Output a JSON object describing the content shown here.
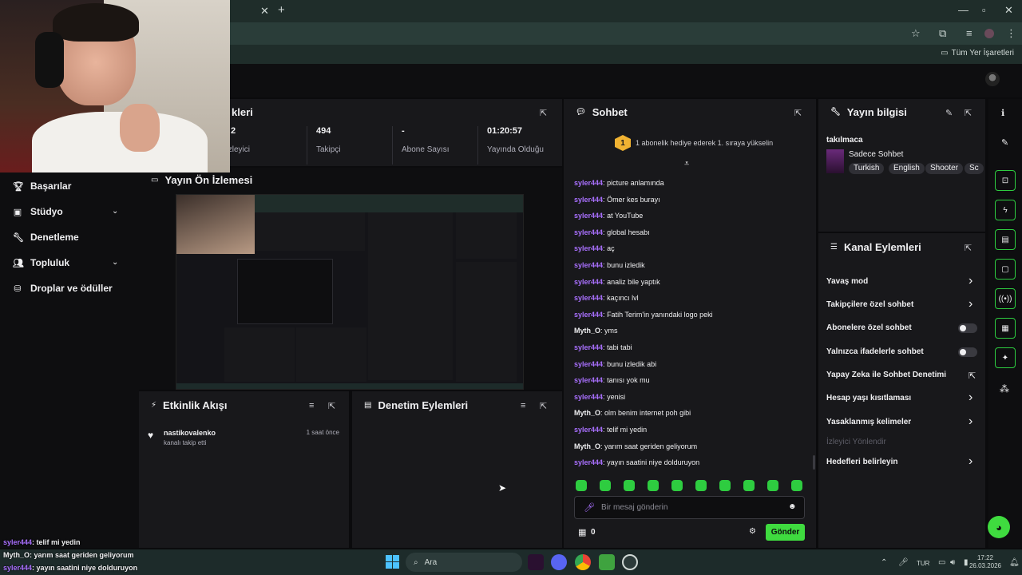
{
  "browser": {
    "bookmarks_all": "Tüm Yer İşaretleri"
  },
  "sidebar": {
    "items": [
      {
        "label": "Başarılar",
        "icon": "trophy-icon"
      },
      {
        "label": "Stüdyo",
        "icon": "studio-icon",
        "expandable": true
      },
      {
        "label": "Denetleme",
        "icon": "wrench-icon"
      },
      {
        "label": "Topluluk",
        "icon": "community-icon",
        "expandable": true
      },
      {
        "label": "Droplar ve ödüller",
        "icon": "drops-icon"
      }
    ]
  },
  "stats": {
    "title_fragment": "kleri",
    "cells": [
      {
        "value": "2",
        "label": "İzleyici"
      },
      {
        "value": "494",
        "label": "Takipçi"
      },
      {
        "value": "-",
        "label": "Abone Sayısı"
      },
      {
        "value": "01:20:57",
        "label": "Yayında Olduğu"
      }
    ]
  },
  "preview": {
    "title": "Yayın Ön İzlemesi"
  },
  "activity": {
    "title": "Etkinlik Akışı",
    "events": [
      {
        "user": "nastikovalenko",
        "text": "kanalı takip etti",
        "time": "1 saat önce"
      }
    ]
  },
  "moderation": {
    "title": "Denetim Eylemleri"
  },
  "chat": {
    "title": "Sohbet",
    "gift_banner": "1 abonelik hediye ederek 1. sıraya yükselin",
    "gift_rank": "1",
    "user_color": "#a970ff",
    "messages": [
      {
        "user": "syler444",
        "text": "picture anlamında"
      },
      {
        "user": "syler444",
        "text": "Ömer kes burayı"
      },
      {
        "user": "syler444",
        "text": "at YouTube"
      },
      {
        "user": "syler444",
        "text": "global hesabı"
      },
      {
        "user": "syler444",
        "text": "aç"
      },
      {
        "user": "syler444",
        "text": "bunu izledik"
      },
      {
        "user": "syler444",
        "text": "analiz bile yaptık"
      },
      {
        "user": "syler444",
        "text": "kaçıncı lvl"
      },
      {
        "user": "syler444",
        "text": "Fatih Terim'in yanındaki logo peki"
      },
      {
        "user": "Myth_O",
        "text": "yms"
      },
      {
        "user": "syler444",
        "text": "tabi tabi"
      },
      {
        "user": "syler444",
        "text": "bunu izledik abi"
      },
      {
        "user": "syler444",
        "text": "tanısı yok mu"
      },
      {
        "user": "syler444",
        "text": "yenisi"
      },
      {
        "user": "Myth_O",
        "text": "olm benim internet poh gibi"
      },
      {
        "user": "syler444",
        "text": "telif mi yedin"
      },
      {
        "user": "Myth_O",
        "text": "yarım saat geriden geliyorum"
      },
      {
        "user": "syler444",
        "text": "yayın saatini niye dolduruyon"
      }
    ],
    "input_placeholder": "Bir mesaj gönderin",
    "points": "0",
    "send_label": "Gönder"
  },
  "stream_info": {
    "title": "Yayın bilgisi",
    "stream_title": "takılmaca",
    "category": "Sadece Sohbet",
    "tags": [
      "Turkish",
      "English",
      "Shooter",
      "Sc"
    ]
  },
  "channel_actions": {
    "title": "Kanal Eylemleri",
    "items": [
      {
        "label": "Yavaş mod",
        "control": "chevron"
      },
      {
        "label": "Takipçilere özel sohbet",
        "control": "chevron"
      },
      {
        "label": "Abonelere özel sohbet",
        "control": "toggle",
        "on": false
      },
      {
        "label": "Yalnızca ifadelerle sohbet",
        "control": "toggle",
        "on": false
      },
      {
        "label": "Yapay Zeka ile Sohbet Denetimi",
        "control": "external"
      },
      {
        "label": "Hesap yaşı kısıtlaması",
        "control": "chevron"
      },
      {
        "label": "Yasaklanmış kelimeler",
        "control": "chevron"
      },
      {
        "label": "İzleyici Yönlendir",
        "control": "disabled"
      },
      {
        "label": "Hedefleri belirleyin",
        "control": "chevron"
      }
    ]
  },
  "taskbar": {
    "search_placeholder": "Ara",
    "lang": "TUR",
    "time": "17:22",
    "date": "26.03.2026"
  },
  "overlay_chat": [
    {
      "user": "syler444",
      "text": ": telif mi yedin"
    },
    {
      "user": "Myth_O",
      "text": ": yarım saat geriden geliyorum"
    },
    {
      "user": "syler444",
      "text": ": yayın saatini niye dolduruyon"
    }
  ],
  "colors": {
    "accent": "#53fc18",
    "panel_bg": "#18181b",
    "username": "#a970ff"
  }
}
